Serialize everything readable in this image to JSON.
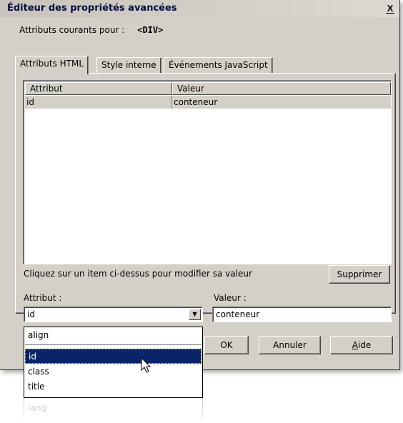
{
  "dialog": {
    "title": "Éditeur des propriétés avancées",
    "close_label": "X",
    "current_attributes_label": "Attributs courants pour :",
    "current_tag": "<DIV>"
  },
  "tabs": [
    {
      "label": "Attributs HTML",
      "active": true
    },
    {
      "label": "Style interne",
      "active": false
    },
    {
      "label": "Événements JavaScript",
      "active": false
    }
  ],
  "table": {
    "columns": [
      "Attribut",
      "Valeur"
    ],
    "rows": [
      {
        "attribute": "id",
        "value": "conteneur"
      }
    ]
  },
  "hint": "Cliquez sur un item ci-dessus pour modifier sa valeur",
  "buttons": {
    "delete": "Supprimer",
    "ok": "OK",
    "cancel": "Annuler",
    "help_underlined": "A",
    "help_rest": "ide"
  },
  "attribute_label": "Attribut :",
  "value_label": "Valeur :",
  "attribute_combo_value": "id",
  "value_input_value": "conteneur",
  "dropdown_items": [
    "align",
    "id",
    "class",
    "title",
    "lang"
  ],
  "dropdown_selected": "id"
}
